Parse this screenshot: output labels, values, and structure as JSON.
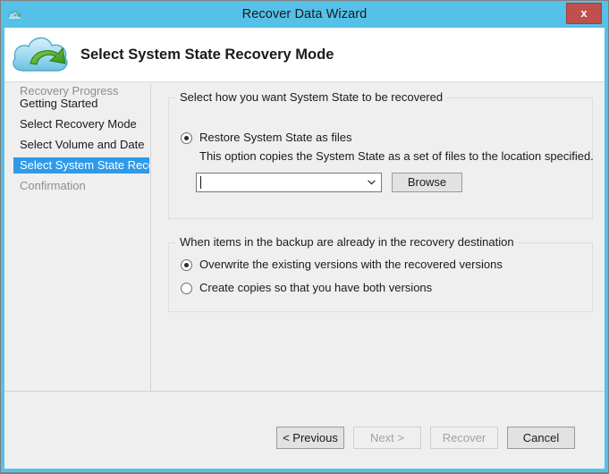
{
  "window": {
    "title": "Recover Data Wizard",
    "title_icon": "cloud-icon",
    "close_label": "x",
    "accent_color": "#55c1e8",
    "close_color": "#c0504d"
  },
  "header": {
    "icon": "cloud-recovery-icon",
    "title": "Select System State Recovery Mode"
  },
  "sidebar": {
    "items": [
      {
        "label": "Getting Started",
        "state": "normal"
      },
      {
        "label": "Select Recovery Mode",
        "state": "normal"
      },
      {
        "label": "Select Volume and Date",
        "state": "normal"
      },
      {
        "label": "Select System State Reco...",
        "state": "selected"
      },
      {
        "label": "Confirmation",
        "state": "disabled"
      },
      {
        "label": "Recovery Progress",
        "state": "disabled"
      }
    ],
    "selected_color": "#2f9ae8"
  },
  "main": {
    "group_how": {
      "legend": "Select how you want System State to be recovered",
      "option_restore": {
        "label": "Restore System State as files",
        "checked": true
      },
      "hint": "This option copies the System State as a set of files to the location specified.",
      "path_combo": {
        "value": "",
        "placeholder": "",
        "arrow_icon": "chevron-down-icon"
      },
      "browse_label": "Browse"
    },
    "group_when": {
      "legend": "When items in the backup are already in the recovery destination",
      "option_overwrite": {
        "label": "Overwrite the existing versions with the recovered versions",
        "checked": true
      },
      "option_copies": {
        "label": "Create copies so that you have both versions",
        "checked": false
      }
    }
  },
  "footer": {
    "buttons": [
      {
        "label": "< Previous",
        "enabled": true
      },
      {
        "label": "Next >",
        "enabled": false
      },
      {
        "label": "Recover",
        "enabled": false
      },
      {
        "label": "Cancel",
        "enabled": true
      }
    ]
  }
}
